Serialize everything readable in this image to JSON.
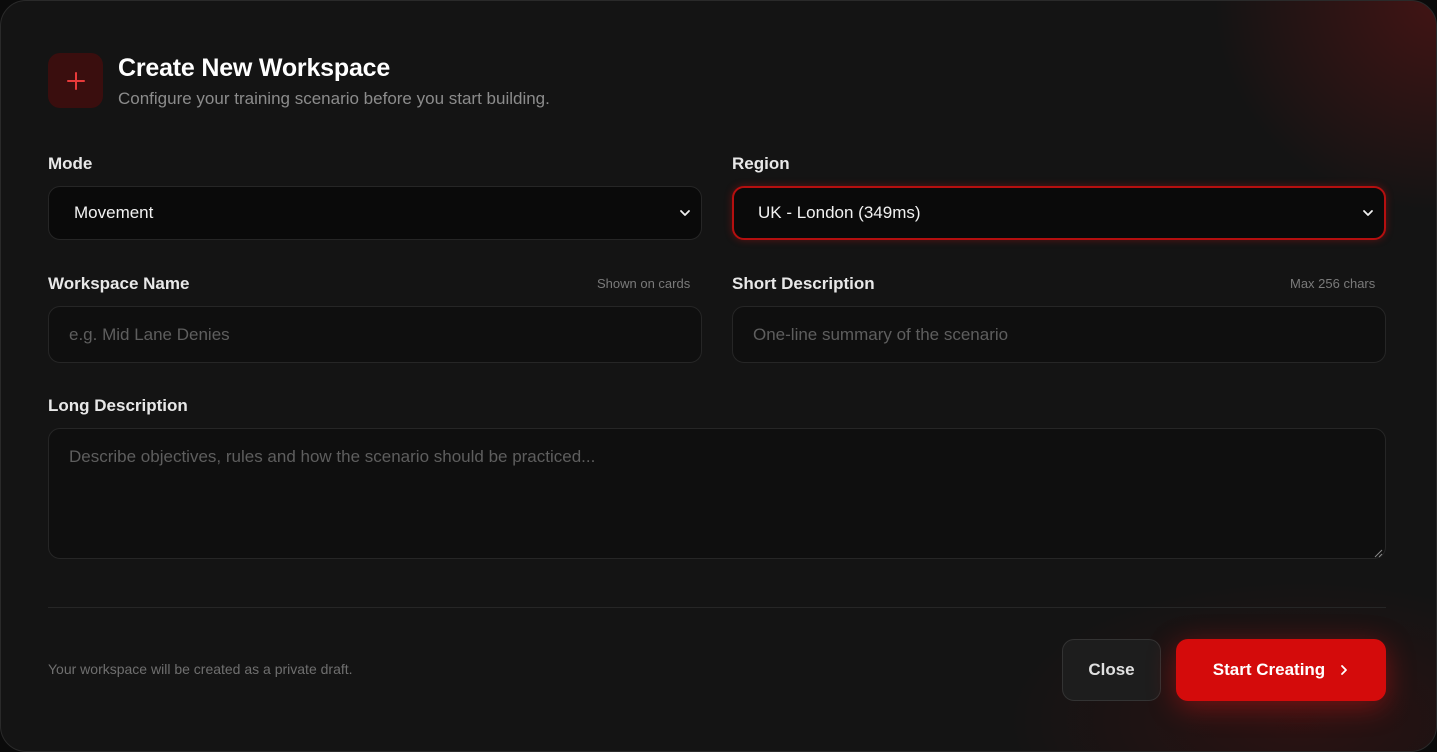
{
  "header": {
    "icon": "plus-icon",
    "title": "Create New Workspace",
    "subtitle": "Configure your training scenario before you start building."
  },
  "form": {
    "mode": {
      "label": "Mode",
      "selected": "Movement"
    },
    "region": {
      "label": "Region",
      "selected": "UK - London (349ms)"
    },
    "workspace_name": {
      "label": "Workspace Name",
      "hint": "Shown on cards",
      "placeholder": "e.g. Mid Lane Denies",
      "value": ""
    },
    "short_description": {
      "label": "Short Description",
      "hint": "Max 256 chars",
      "placeholder": "One-line summary of the scenario",
      "value": ""
    },
    "long_description": {
      "label": "Long Description",
      "placeholder": "Describe objectives, rules and how the scenario should be practiced...",
      "value": ""
    }
  },
  "footer": {
    "note": "Your workspace will be created as a private draft.",
    "close_label": "Close",
    "start_label": "Start Creating"
  },
  "colors": {
    "accent": "#d40b0b",
    "background": "#141414",
    "icon_tile": "#3a0e0e"
  }
}
